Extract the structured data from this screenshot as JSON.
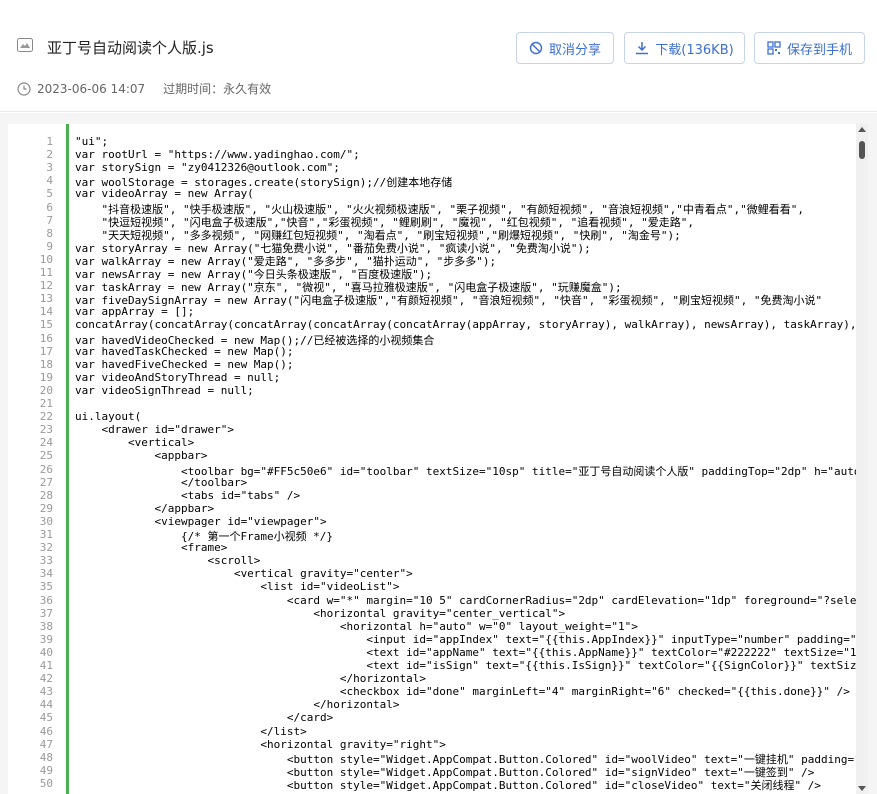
{
  "header": {
    "file_name": "亚丁号自动阅读个人版.js",
    "date": "2023-06-06 14:07",
    "expire_label": "过期时间：永久有效",
    "buttons": {
      "cancel_share": "取消分享",
      "download": "下载(136KB)",
      "save_to_phone": "保存到手机"
    }
  },
  "colors": {
    "accent": "#3d6fd1",
    "gutter_bar": "#4caf50"
  },
  "icons": [
    "file-icon",
    "clock-icon",
    "cancel-share-icon",
    "download-icon",
    "save-phone-icon"
  ],
  "code": {
    "lines": [
      "\"ui\";",
      "var rootUrl = \"https://www.yadinghao.com/\";",
      "var storySign = \"zy0412326@outlook.com\";",
      "var woolStorage = storages.create(storySign);//创建本地存储",
      "var videoArray = new Array(",
      "    \"抖音极速版\", \"快手极速版\", \"火山极速版\", \"火火视频极速版\", \"栗子视频\", \"有颜短视频\", \"音浪短视频\",\"中青看点\",\"微鲤看看\",",
      "    \"快逗短视频\", \"闪电盒子极速版\",\"快音\",\"彩蛋视频\", \"鲤刷刷\", \"魔视\", \"红包视频\", \"追看视频\", \"爱走路\",",
      "    \"天天短视频\", \"多多视频\", \"网赚红包短视频\", \"淘看点\", \"刷宝短视频\",\"刷爆短视频\", \"快刷\", \"淘金号\");",
      "var storyArray = new Array(\"七猫免费小说\", \"番茄免费小说\", \"疯读小说\", \"免费淘小说\");",
      "var walkArray = new Array(\"爱走路\", \"多多步\", \"猫扑运动\", \"步多多\");",
      "var newsArray = new Array(\"今日头条极速版\", \"百度极速版\");",
      "var taskArray = new Array(\"京东\", \"微视\", \"喜马拉雅极速版\", \"闪电盒子极速版\", \"玩赚魔盒\");",
      "var fiveDaySignArray = new Array(\"闪电盒子极速版\",\"有颜短视频\", \"音浪短视频\", \"快音\", \"彩蛋视频\", \"刷宝短视频\", \"免费淘小说\"",
      "var appArray = [];",
      "concatArray(concatArray(concatArray(concatArray(concatArray(appArray, storyArray), walkArray), newsArray), taskArray),",
      "var havedVideoChecked = new Map();//已经被选择的小视频集合",
      "var havedTaskChecked = new Map();",
      "var havedFiveChecked = new Map();",
      "var videoAndStoryThread = null;",
      "var videoSignThread = null;",
      "",
      "ui.layout(",
      "    <drawer id=\"drawer\">",
      "        <vertical>",
      "            <appbar>",
      "                <toolbar bg=\"#FF5c50e6\" id=\"toolbar\" textSize=\"10sp\" title=\"亚丁号自动阅读个人版\" paddingTop=\"2dp\" h=\"auto\"",
      "                </toolbar>",
      "                <tabs id=\"tabs\" />",
      "            </appbar>",
      "            <viewpager id=\"viewpager\">",
      "                {/* 第一个Frame小视频 */}",
      "                <frame>",
      "                    <scroll>",
      "                        <vertical gravity=\"center\">",
      "                            <list id=\"videoList\">",
      "                                <card w=\"*\" margin=\"10 5\" cardCornerRadius=\"2dp\" cardElevation=\"1dp\" foreground=\"?selectableItem",
      "                                    <horizontal gravity=\"center_vertical\">",
      "                                        <horizontal h=\"auto\" w=\"0\" layout_weight=\"1\">",
      "                                            <input id=\"appIndex\" text=\"{{this.AppIndex}}\" inputType=\"number\" padding=\"",
      "                                            <text id=\"appName\" text=\"{{this.AppName}}\" textColor=\"#222222\" textSize=\"1",
      "                                            <text id=\"isSign\" text=\"{{this.IsSign}}\" textColor=\"{{SignColor}}\" textSiz",
      "                                        </horizontal>",
      "                                        <checkbox id=\"done\" marginLeft=\"4\" marginRight=\"6\" checked=\"{{this.done}}\" />",
      "                                    </horizontal>",
      "                                </card>",
      "                            </list>",
      "                            <horizontal gravity=\"right\">",
      "                                <button style=\"Widget.AppCompat.Button.Colored\" id=\"woolVideo\" text=\"一键挂机\" padding=\"",
      "                                <button style=\"Widget.AppCompat.Button.Colored\" id=\"signVideo\" text=\"一键签到\" />",
      "                                <button style=\"Widget.AppCompat.Button.Colored\" id=\"closeVideo\" text=\"关闭线程\" />"
    ]
  }
}
